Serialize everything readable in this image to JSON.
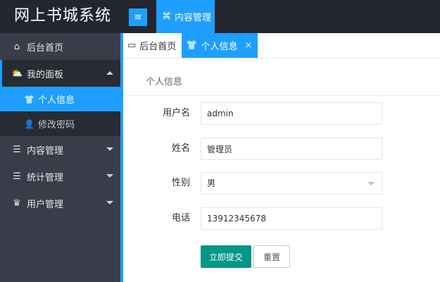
{
  "header": {
    "app_title": "网上书城系统",
    "menu_toggle_glyph": "≡",
    "top_nav": [
      {
        "label": "内容管理",
        "icon": "content-icon",
        "glyph": "⌘"
      }
    ]
  },
  "sidebar": {
    "items": [
      {
        "label": "后台首页",
        "icon": "home-icon",
        "glyph": "⌂"
      },
      {
        "label": "我的面板",
        "icon": "weather-icon",
        "glyph": "⛅",
        "expanded": true,
        "children": [
          {
            "label": "个人信息",
            "icon": "tshirt-icon",
            "glyph": "👕",
            "active": true
          },
          {
            "label": "修改密码",
            "icon": "user-lock-icon",
            "glyph": "👤"
          }
        ]
      },
      {
        "label": "内容管理",
        "icon": "list-icon",
        "glyph": "☰"
      },
      {
        "label": "统计管理",
        "icon": "list-icon",
        "glyph": "☰"
      },
      {
        "label": "用户管理",
        "icon": "crown-icon",
        "glyph": "♛"
      }
    ]
  },
  "tabs": [
    {
      "label": "后台首页",
      "icon": "monitor-icon",
      "glyph": "▭"
    },
    {
      "label": "个人信息",
      "icon": "tshirt-icon",
      "glyph": "👕",
      "active": true,
      "close_glyph": "×"
    }
  ],
  "form": {
    "section_title": "个人信息",
    "fields": [
      {
        "label": "用户名",
        "value": "admin"
      },
      {
        "label": "姓名",
        "value": "管理员"
      },
      {
        "label": "性别",
        "value": "男"
      },
      {
        "label": "电话",
        "value": "13912345678"
      }
    ],
    "submit_label": "立即提交",
    "reset_label": "重置"
  },
  "colors": {
    "header_bg": "#23262e",
    "sidebar_bg": "#393D49",
    "accent_blue": "#1E9FFF",
    "submit_green": "#009688"
  }
}
